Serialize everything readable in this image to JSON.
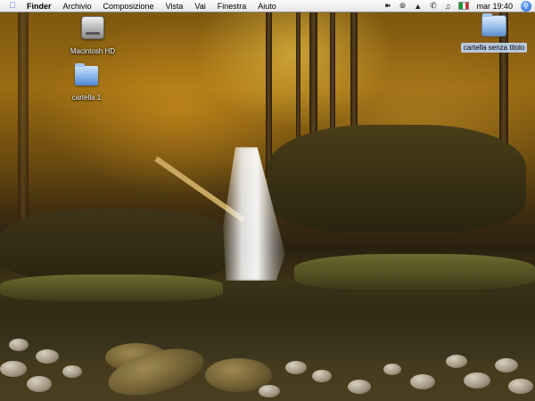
{
  "menubar": {
    "apple_icon": "apple-icon",
    "app_menu": "Finder",
    "menus": [
      "Archivio",
      "Composizione",
      "Vista",
      "Vai",
      "Finestra",
      "Aiuto"
    ],
    "status_icons": [
      "script-icon",
      "bluetooth-icon",
      "airport-wifi-icon",
      "phone-icon",
      "volume-icon"
    ],
    "input_flag": "IT",
    "flag_colors": [
      "#1a9a3a",
      "#ffffff",
      "#d22b2b"
    ],
    "clock": "mar 19:40",
    "spotlight_icon": "spotlight-search-icon"
  },
  "desktop_icons": [
    {
      "label": "Macintosh HD",
      "icon": "hard-drive-icon",
      "selected": false
    },
    {
      "label": "cartella 1",
      "icon": "folder-icon",
      "selected": false
    },
    {
      "label": "cartella senza titolo",
      "icon": "folder-icon",
      "selected": true
    }
  ],
  "theme": {
    "menubar_bg": "#ececec",
    "selection_label_bg": "#b8c8de",
    "folder_blue": "#7fb0ea"
  }
}
